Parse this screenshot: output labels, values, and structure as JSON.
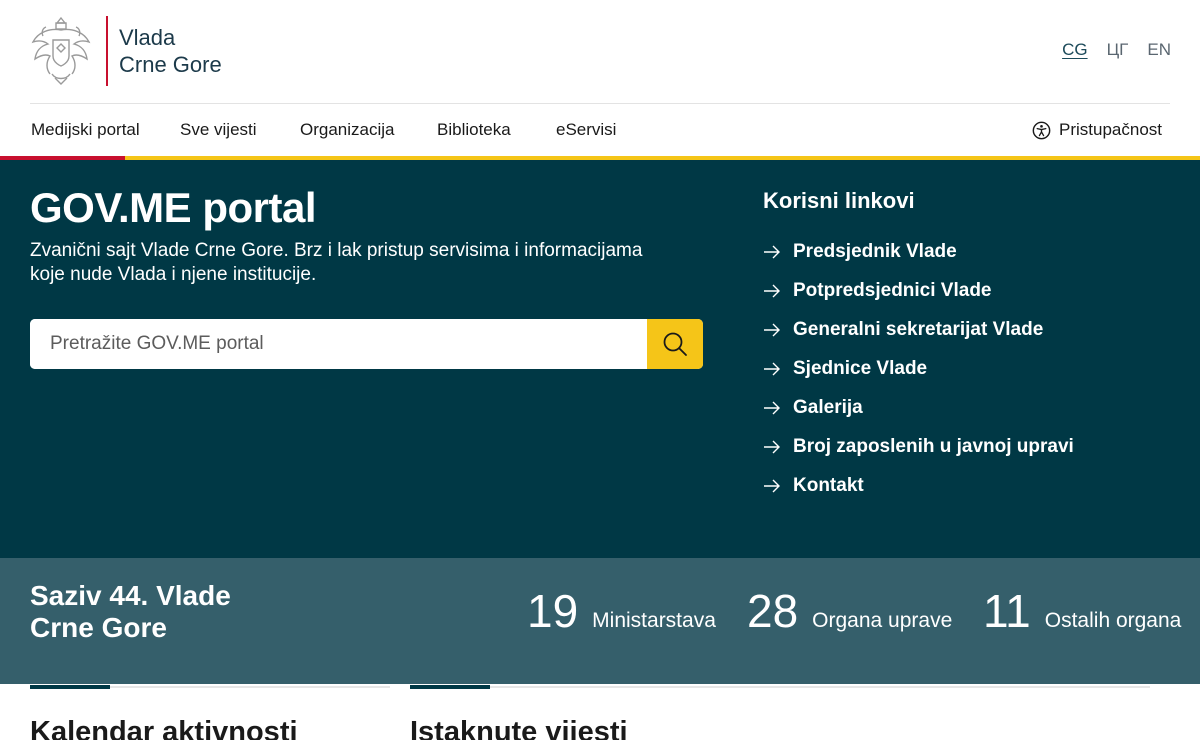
{
  "header": {
    "brand_line1": "Vlada",
    "brand_line2": "Crne Gore",
    "languages": [
      {
        "label": "CG",
        "active": true
      },
      {
        "label": "ЦГ",
        "active": false
      },
      {
        "label": "EN",
        "active": false
      }
    ]
  },
  "nav": {
    "items": [
      "Medijski portal",
      "Sve vijesti",
      "Organizacija",
      "Biblioteka",
      "eServisi"
    ],
    "accessibility_label": "Pristupačnost"
  },
  "hero": {
    "title": "GOV.ME portal",
    "description": "Zvanični sajt Vlade Crne Gore. Brz i lak pristup servisima i informacijama koje nude Vlada i njene institucije.",
    "search_placeholder": "Pretražite GOV.ME portal",
    "links_title": "Korisni linkovi",
    "links": [
      "Predsjednik Vlade",
      "Potpredsjednici Vlade",
      "Generalni sekretarijat Vlade",
      "Sjednice Vlade",
      "Galerija",
      "Broj zaposlenih u javnoj upravi",
      "Kontakt"
    ]
  },
  "stats": {
    "title_line1": "Saziv 44. Vlade",
    "title_line2": "Crne Gore",
    "items": [
      {
        "number": "19",
        "label": "Ministarstava"
      },
      {
        "number": "28",
        "label": "Organa uprave"
      },
      {
        "number": "11",
        "label": "Ostalih organa"
      }
    ]
  },
  "sections": {
    "calendar_title": "Kalendar aktivnosti",
    "news_title": "Istaknute vijesti"
  },
  "colors": {
    "hero_bg": "#003845",
    "stats_bg": "#355f6b",
    "accent_red": "#c8102e",
    "accent_yellow": "#f5c518"
  },
  "icons": {
    "crest": "montenegro-coat-of-arms-icon",
    "search": "search-icon",
    "accessibility": "accessibility-icon",
    "link_arrow": "arrow-right-icon"
  }
}
